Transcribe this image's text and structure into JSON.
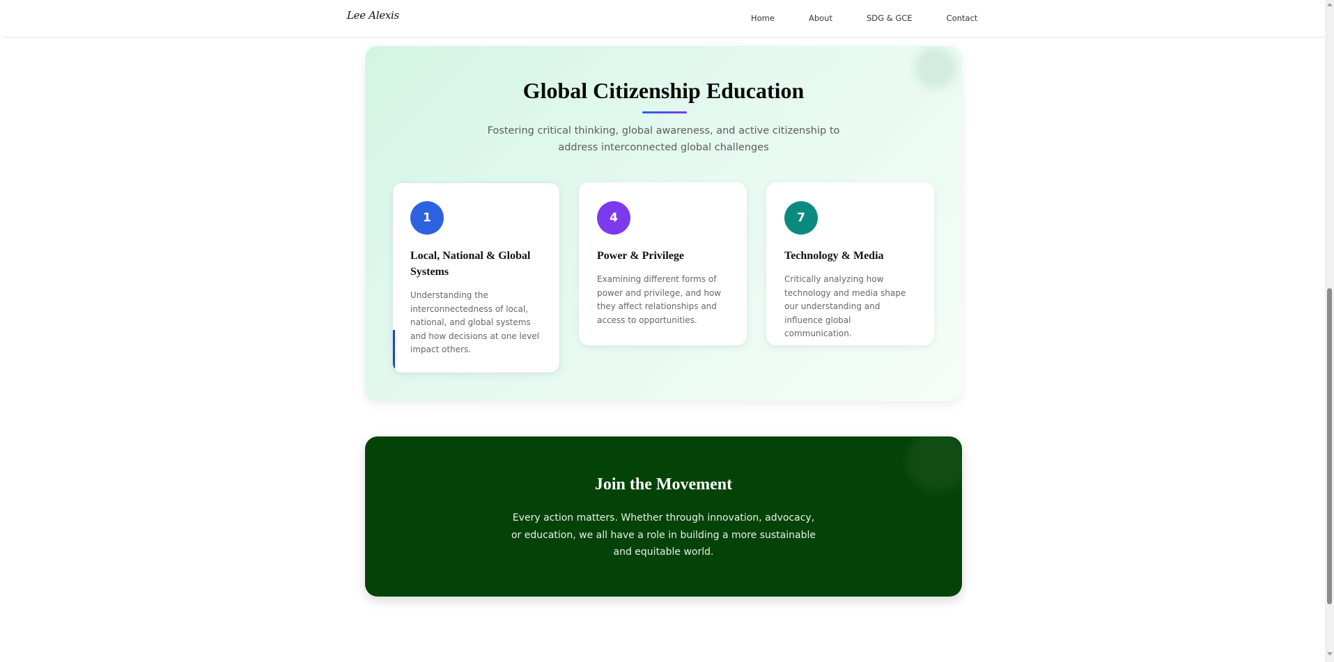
{
  "nav": {
    "brand": "Lee Alexis",
    "links": [
      "Home",
      "About",
      "SDG & GCE",
      "Contact"
    ]
  },
  "gce": {
    "title": "Global Citizenship Education",
    "subtitle": "Fostering critical thinking, global awareness, and active citizenship to address interconnected global challenges",
    "cards": [
      {
        "number": "1",
        "title": "Local, National & Global Systems",
        "description": "Understanding the interconnectedness of local, national, and global systems and how decisions at one level impact others.",
        "color": "#2d62e0"
      },
      {
        "number": "4",
        "title": "Power & Privilege",
        "description": "Examining different forms of power and privilege, and how they affect relationships and access to opportunities.",
        "color": "#7c3aed"
      },
      {
        "number": "7",
        "title": "Technology & Media",
        "description": "Critically analyzing how technology and media shape our understanding and influence global communication.",
        "color": "#0d8a80"
      }
    ]
  },
  "join": {
    "title": "Join the Movement",
    "text": "Every action matters. Whether through innovation, advocacy, or education, we all have a role in building a more sustainable and equitable world."
  },
  "colors": {
    "accent_gradient_start": "#2563eb",
    "accent_gradient_end": "#7c3aed",
    "join_background": "#044307",
    "gce_background": "#d4f5e4"
  }
}
